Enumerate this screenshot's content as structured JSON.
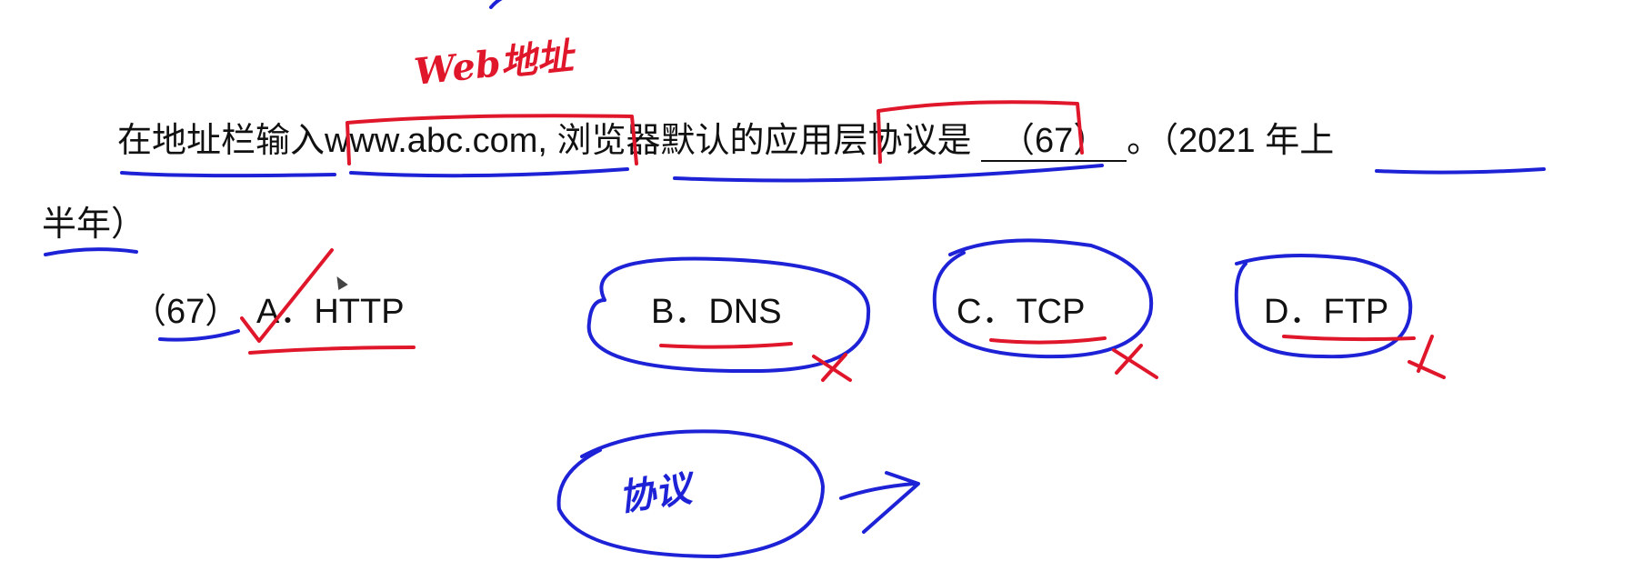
{
  "question": {
    "stem_part1": "在地址栏输入",
    "url": "www.abc.com,",
    "stem_part2": " 浏览器默认的应用层协议是",
    "blank": "（67）",
    "stem_part3": "。（2021 年上",
    "stem_part4": "半年）",
    "number_label": "（67）"
  },
  "options": [
    {
      "letter": "A",
      "text": "A．HTTP",
      "mark": "check"
    },
    {
      "letter": "B",
      "text": "B．DNS",
      "mark": "cross"
    },
    {
      "letter": "C",
      "text": "C．TCP",
      "mark": "cross"
    },
    {
      "letter": "D",
      "text": "D．FTP",
      "mark": "cross"
    }
  ],
  "annotations": {
    "above_url": "Web地址",
    "bottom_circle": "协议",
    "colors": {
      "red": "#e0162b",
      "blue": "#1e22d6"
    }
  }
}
